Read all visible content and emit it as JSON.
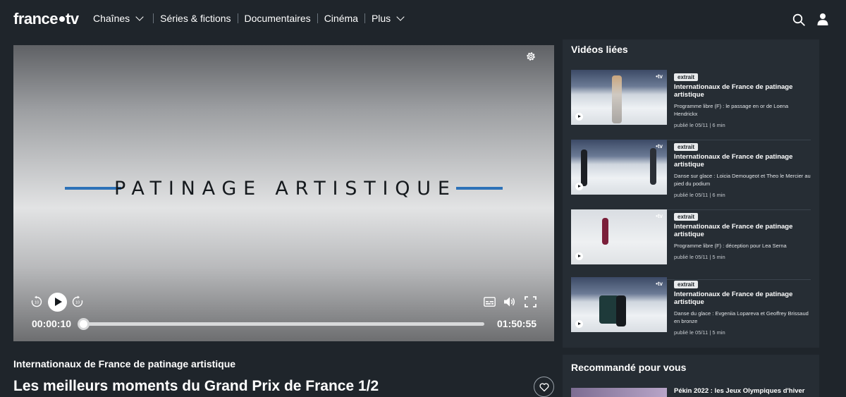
{
  "header": {
    "logo": {
      "brand": "france",
      "suffix": "tv"
    },
    "nav": [
      {
        "label": "Chaînes",
        "dropdown": true
      },
      {
        "label": "Séries & fictions",
        "dropdown": false
      },
      {
        "label": "Documentaires",
        "dropdown": false
      },
      {
        "label": "Cinéma",
        "dropdown": false
      },
      {
        "label": "Plus",
        "dropdown": true
      }
    ],
    "icons": [
      "search-icon",
      "user-icon"
    ]
  },
  "player": {
    "title_card": "PATINAGE ARTISTIQUE",
    "current_time": "00:00:10",
    "total_time": "01:50:55",
    "progress": 0.0015,
    "controls": [
      "rewind-10-icon",
      "play-icon",
      "forward-10-icon",
      "subtitles-icon",
      "volume-icon",
      "fullscreen-icon",
      "settings-gear-icon"
    ],
    "accent_color": "#2d72b8"
  },
  "program": {
    "name": "Internationaux de France de patinage artistique",
    "title": "Les meilleurs moments du Grand Prix de France 1/2"
  },
  "related": {
    "heading": "Vidéos liées",
    "items": [
      {
        "badge": "extrait",
        "title": "Internationaux de France de patinage artistique",
        "description": "Programme libre (F) : le passage en or de Loena Hendrickx",
        "meta": "publié le 05/11 | 6 min",
        "tv_badge": "•tv"
      },
      {
        "badge": "extrait",
        "title": "Internationaux de France de patinage artistique",
        "description": "Danse sur glace : Loicia Demougeot et Theo le Mercier au pied du podium",
        "meta": "publié le 05/11 | 6 min",
        "tv_badge": "•tv"
      },
      {
        "badge": "extrait",
        "title": "Internationaux de France de patinage artistique",
        "description": "Programme libre (F) : déception pour Lea Serna",
        "meta": "publié le 05/11 | 5 min",
        "tv_badge": "•tv"
      },
      {
        "badge": "extrait",
        "title": "Internationaux de France de patinage artistique",
        "description": "Danse du glace : Evgeniia Lopareva et Geoffrey Brissaud en bronze",
        "meta": "publié le 05/11 | 5 min",
        "tv_badge": "•tv"
      }
    ]
  },
  "recommended": {
    "heading": "Recommandé pour vous",
    "first_title": "Pékin 2022 : les Jeux Olympiques d'hiver"
  }
}
